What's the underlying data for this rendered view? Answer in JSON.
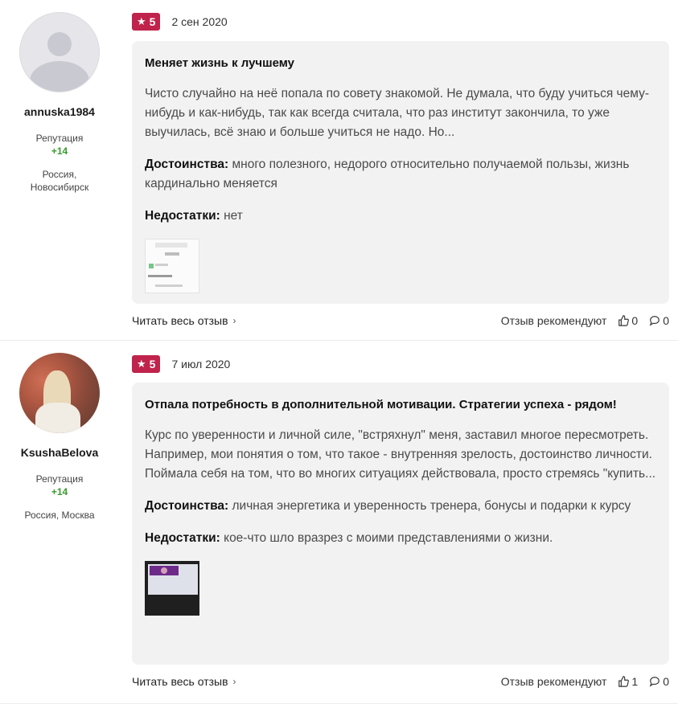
{
  "reviews": [
    {
      "user": {
        "name": "annuska1984",
        "reputation_label": "Репутация",
        "reputation_value": "+14",
        "location": "Россия, Новосибирск"
      },
      "rating": "5",
      "date": "2 сен 2020",
      "title": "Меняет жизнь к лучшему",
      "text": "Чисто случайно на неё попала по совету знакомой. Не думала, что буду учиться чему-нибудь и как-нибудь, так как всегда считала, что раз институт закончила, то уже выучилась, всё знаю и больше учиться не надо. Но...",
      "pros_label": "Достоинства:",
      "pros": "много полезного, недорого относительно получаемой пользы, жизнь кардинально меняется",
      "cons_label": "Недостатки:",
      "cons": "нет",
      "read_more": "Читать весь отзыв",
      "recommend_label": "Отзыв рекомендуют",
      "likes": "0",
      "comments": "0"
    },
    {
      "user": {
        "name": "KsushaBelova",
        "reputation_label": "Репутация",
        "reputation_value": "+14",
        "location": "Россия, Москва"
      },
      "rating": "5",
      "date": "7 июл 2020",
      "title": "Отпала потребность в дополнительной мотивации. Стратегии успеха - рядом!",
      "text": "Курс по уверенности и личной силе, \"встряхнул\" меня, заставил многое пересмотреть. Например, мои понятия о том, что такое - внутренняя зрелость, достоинство личности. Поймала себя на том, что во многих ситуациях действовала, просто стремясь \"купить...",
      "pros_label": "Достоинства:",
      "pros": "личная энергетика и уверенность тренера, бонусы и подарки к курсу",
      "cons_label": "Недостатки:",
      "cons": "кое-что шло вразрез с моими представлениями о жизни.",
      "read_more": "Читать весь отзыв",
      "recommend_label": "Отзыв рекомендуют",
      "likes": "1",
      "comments": "0"
    }
  ],
  "colors": {
    "rating_badge": "#c0234b",
    "reputation": "#3a9a2e",
    "card_bg": "#f2f2f2"
  },
  "icons": {
    "rating": "star-icon",
    "read_more": "chevron-right-icon",
    "likes": "thumbs-up-icon",
    "comments": "comment-bubble-icon"
  }
}
